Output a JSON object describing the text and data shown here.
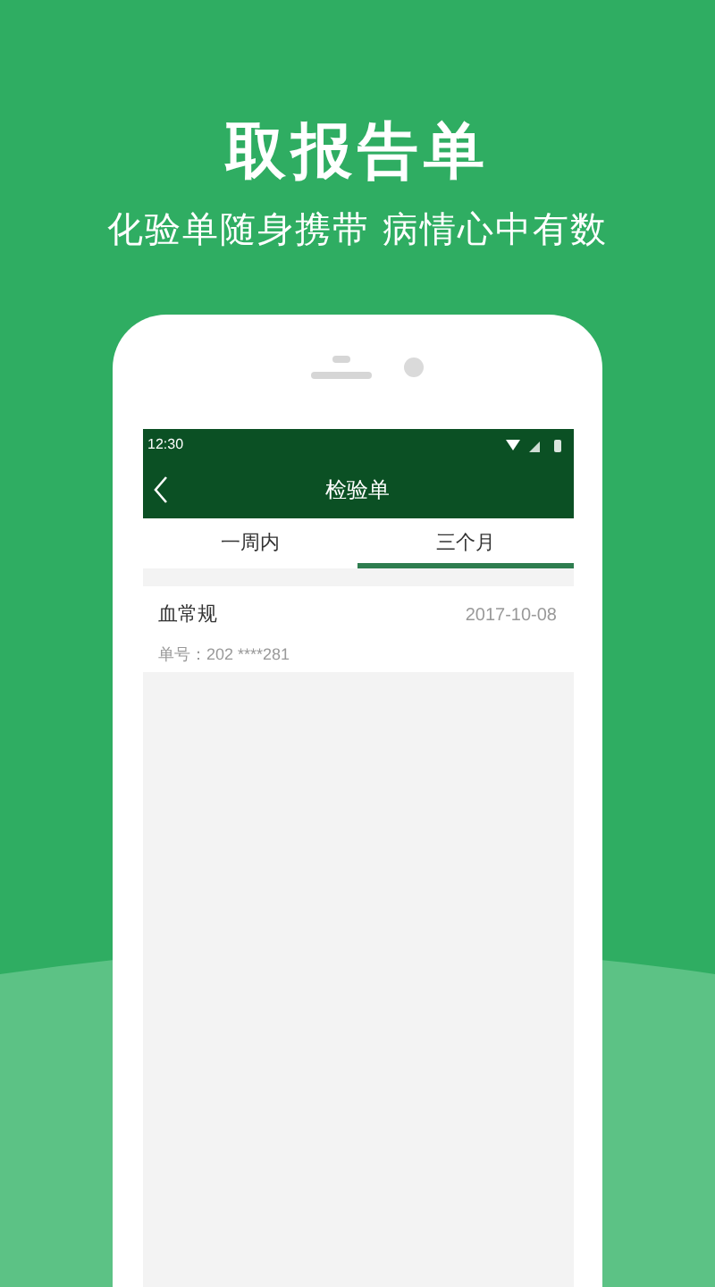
{
  "headline": "取报告单",
  "tagline": "化验单随身携带 病情心中有数",
  "status_bar": {
    "time": "12:30"
  },
  "app_bar": {
    "title": "检验单"
  },
  "tabs": [
    {
      "label": "一周内",
      "selected": false
    },
    {
      "label": "三个月",
      "selected": true
    }
  ],
  "reports": [
    {
      "name": "血常规",
      "date": "2017-10-08",
      "number": "单号：202 ****281"
    }
  ]
}
